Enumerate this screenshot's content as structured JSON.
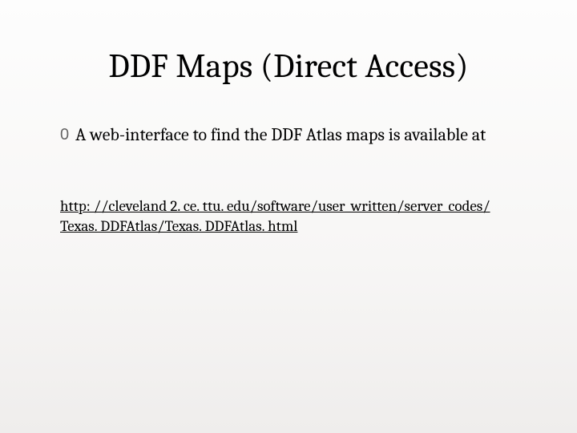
{
  "title": "DDF Maps (Direct Access)",
  "bullet_marker": "0",
  "body_text": "A web-interface to find the DDF Atlas maps is available at",
  "link_line1": "http: //cleveland 2. ce. ttu. edu/software/user_written/server_codes/",
  "link_line2": "Texas. DDFAtlas/Texas. DDFAtlas. html"
}
